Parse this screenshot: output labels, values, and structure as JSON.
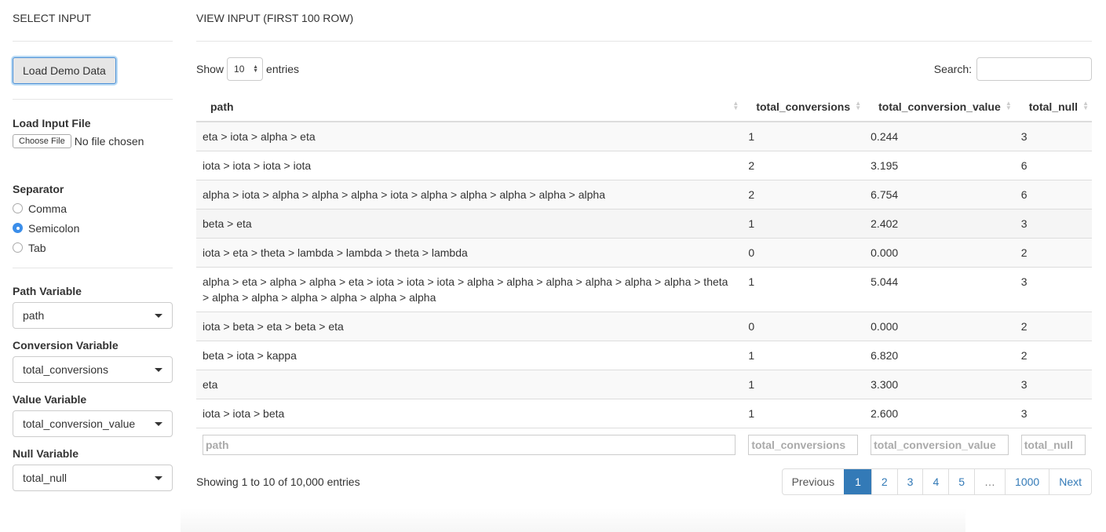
{
  "sidebar": {
    "title": "SELECT INPUT",
    "demo_button": "Load Demo Data",
    "file": {
      "label": "Load Input File",
      "button": "Choose File",
      "status": "No file chosen"
    },
    "separator": {
      "label": "Separator",
      "options": [
        "Comma",
        "Semicolon",
        "Tab"
      ],
      "selected": "Semicolon"
    },
    "path_variable": {
      "label": "Path Variable",
      "value": "path"
    },
    "conversion_variable": {
      "label": "Conversion Variable",
      "value": "total_conversions"
    },
    "value_variable": {
      "label": "Value Variable",
      "value": "total_conversion_value"
    },
    "null_variable": {
      "label": "Null Variable",
      "value": "total_null"
    }
  },
  "main": {
    "title": "VIEW INPUT (FIRST 100 ROW)",
    "length": {
      "show": "Show",
      "value": "10",
      "entries": "entries"
    },
    "search": {
      "label": "Search:",
      "value": ""
    },
    "columns": [
      "path",
      "total_conversions",
      "total_conversion_value",
      "total_null"
    ],
    "rows": [
      [
        "eta > iota > alpha > eta",
        "1",
        "0.244",
        "3"
      ],
      [
        "iota > iota > iota > iota",
        "2",
        "3.195",
        "6"
      ],
      [
        "alpha > iota > alpha > alpha > alpha > iota > alpha > alpha > alpha > alpha > alpha",
        "2",
        "6.754",
        "6"
      ],
      [
        "beta > eta",
        "1",
        "2.402",
        "3"
      ],
      [
        "iota > eta > theta > lambda > lambda > theta > lambda",
        "0",
        "0.000",
        "2"
      ],
      [
        "alpha > eta > alpha > alpha > eta > iota > iota > iota > alpha > alpha > alpha > alpha > alpha > alpha > theta > alpha > alpha > alpha > alpha > alpha > alpha",
        "1",
        "5.044",
        "3"
      ],
      [
        "iota > beta > eta > beta > eta",
        "0",
        "0.000",
        "2"
      ],
      [
        "beta > iota > kappa",
        "1",
        "6.820",
        "2"
      ],
      [
        "eta",
        "1",
        "3.300",
        "3"
      ],
      [
        "iota > iota > beta",
        "1",
        "2.600",
        "3"
      ]
    ],
    "filters": [
      "path",
      "total_conversions",
      "total_conversion_value",
      "total_null"
    ],
    "info": "Showing 1 to 10 of 10,000 entries",
    "pagination": {
      "previous": "Previous",
      "pages": [
        "1",
        "2",
        "3",
        "4",
        "5",
        "…",
        "1000"
      ],
      "active": "1",
      "next": "Next"
    },
    "colors": {
      "accent": "#337ab7",
      "radio": "#3b8eea"
    }
  }
}
